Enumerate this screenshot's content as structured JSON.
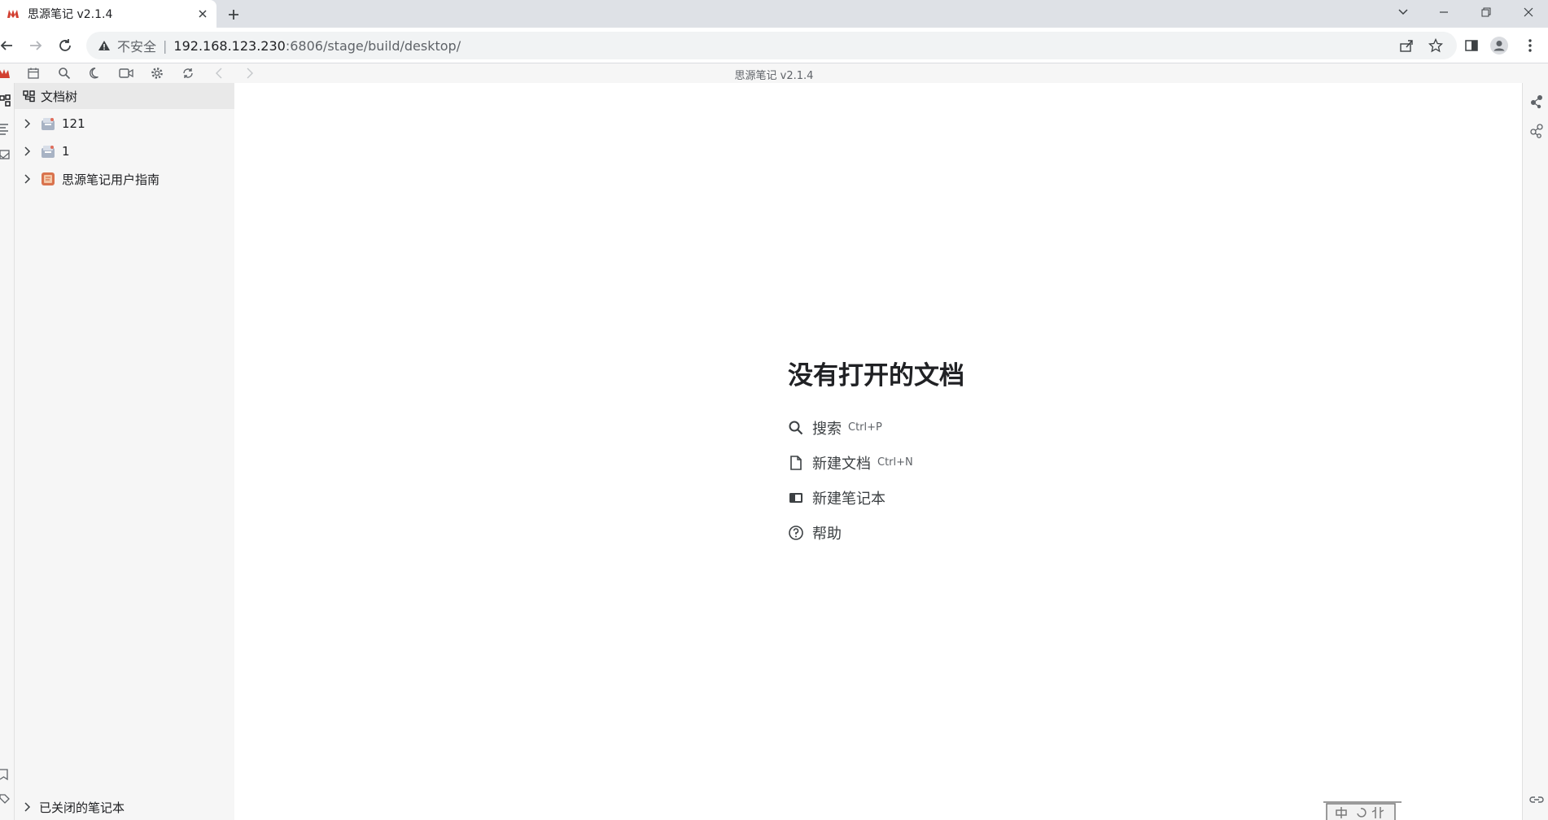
{
  "browser": {
    "tab_title": "思源笔记 v2.1.4",
    "address": {
      "security_label": "不安全",
      "separator": "|",
      "host": "192.168.123.230",
      "path": ":6806/stage/build/desktop/"
    }
  },
  "app": {
    "title": "思源笔记 v2.1.4",
    "toolbar_icons": [
      "siyuan-logo-icon",
      "calendar-icon",
      "search-icon",
      "moon-icon",
      "record-icon",
      "settings-icon",
      "sync-icon",
      "back-icon",
      "forward-icon"
    ],
    "filetree": {
      "header": "文档树",
      "notebooks": [
        {
          "label": "121",
          "icon": "notebook-icon"
        },
        {
          "label": "1",
          "icon": "notebook-icon"
        },
        {
          "label": "思源笔记用户指南",
          "icon": "guide-book-icon"
        }
      ],
      "closed_notebooks_label": "已关闭的笔记本"
    },
    "empty_state": {
      "title": "没有打开的文档",
      "actions": [
        {
          "label": "搜索",
          "shortcut": "Ctrl+P",
          "icon": "search-icon"
        },
        {
          "label": "新建文档",
          "shortcut": "Ctrl+N",
          "icon": "file-icon"
        },
        {
          "label": "新建笔记本",
          "shortcut": "",
          "icon": "notebook-icon"
        },
        {
          "label": "帮助",
          "shortcut": "",
          "icon": "help-icon"
        }
      ]
    }
  },
  "colors": {
    "tabstrip": "#dee1e6",
    "panel": "#f6f6f6",
    "accent_red": "#d23f31",
    "notebook_orange": "#d9734e"
  }
}
